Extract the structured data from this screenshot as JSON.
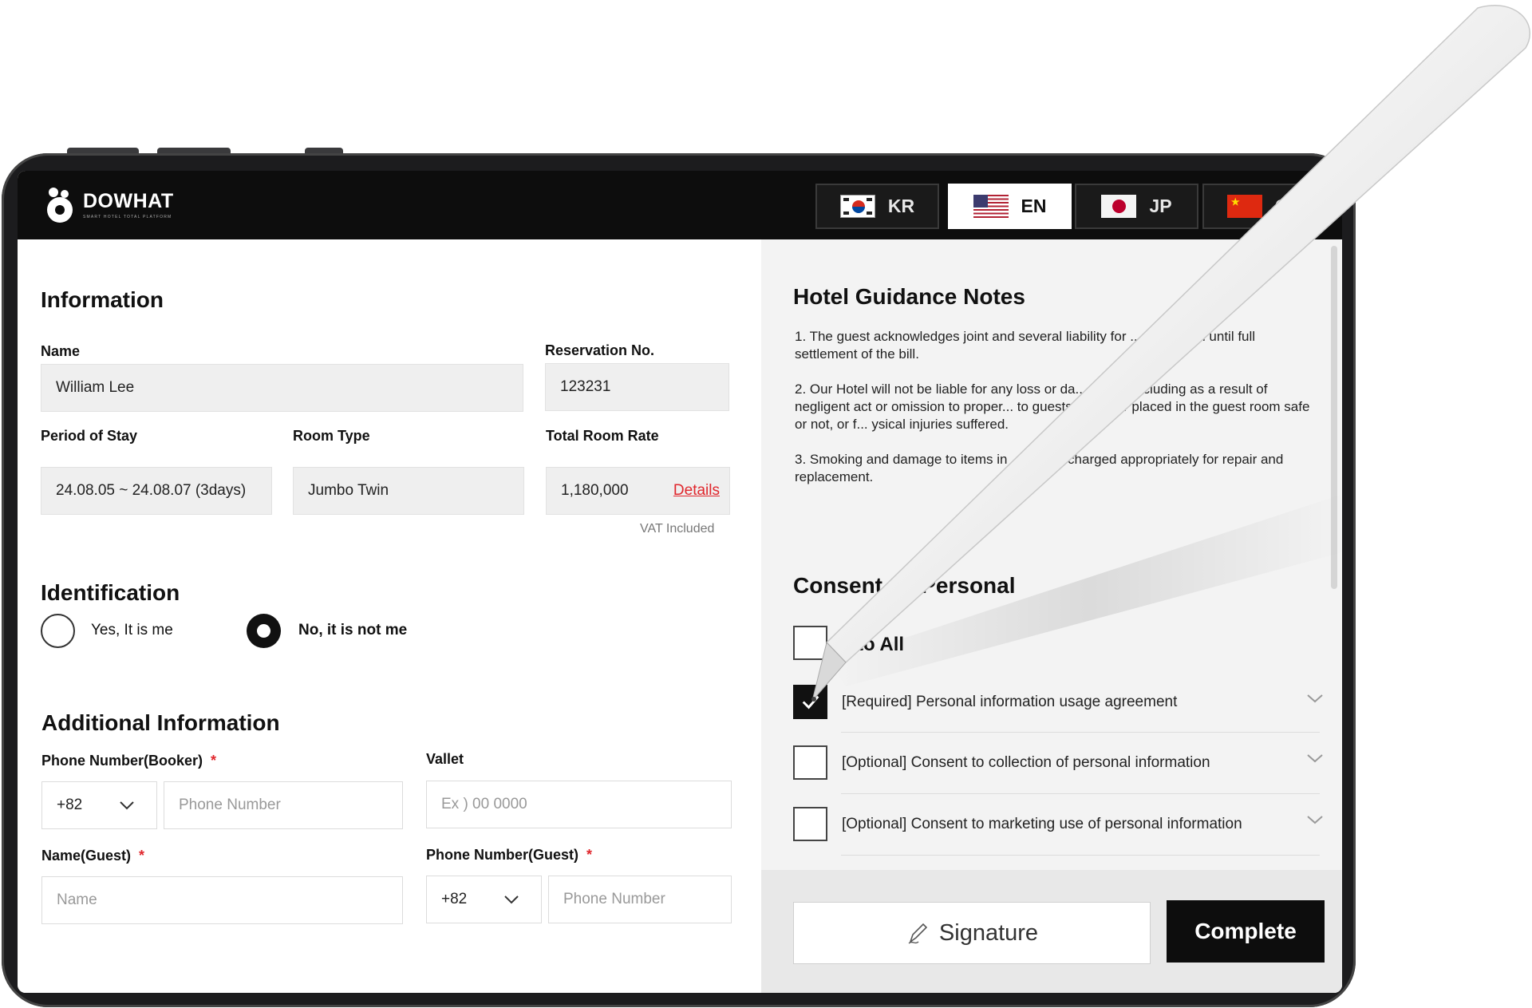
{
  "brand": {
    "name": "DOWHAT",
    "tagline": "SMART HOTEL TOTAL PLATFORM"
  },
  "languages": [
    {
      "code": "KR",
      "flag": "korea-flag-icon"
    },
    {
      "code": "EN",
      "flag": "usa-flag-icon",
      "active": true
    },
    {
      "code": "JP",
      "flag": "japan-flag-icon"
    },
    {
      "code": "CN",
      "flag": "china-flag-icon"
    }
  ],
  "info": {
    "title": "Information",
    "name_label": "Name",
    "name_value": "William Lee",
    "reservation_label": "Reservation No.",
    "reservation_value": "123231",
    "period_label": "Period of Stay",
    "period_value": "24.08.05 ~ 24.08.07 (3days)",
    "room_type_label": "Room Type",
    "room_type_value": "Jumbo Twin",
    "rate_label": "Total Room Rate",
    "rate_value": "1,180,000",
    "details_link": "Details",
    "vat_note": "VAT Included"
  },
  "identification": {
    "title": "Identification",
    "yes_label": "Yes, It is me",
    "no_label": "No, it is not me",
    "selected": "no"
  },
  "additional": {
    "title": "Additional Information",
    "phone_booker_label": "Phone Number(Booker)",
    "required_mark": "*",
    "country_code": "+82",
    "phone_placeholder": "Phone Number",
    "vallet_label": "Vallet",
    "vallet_placeholder": "Ex ) 00   0000",
    "guest_name_label": "Name(Guest)",
    "guest_name_placeholder": "Name",
    "phone_guest_label": "Phone Number(Guest)",
    "guest_country_code": "+82",
    "guest_phone_placeholder": "Phone Number"
  },
  "guidance": {
    "title": "Hotel Guidance Notes",
    "notes": [
      "1. The guest acknowledges joint and several liability for ... registered until full settlement of the bill.",
      "2. Our Hotel will not be liable for any loss or da... nature including as a result of negligent act or omission to proper... to guests, whether placed in the guest room safe or not, or f... ysical injuries suffered.",
      "3. Smoking and damage to items in ... will be charged appropriately for repair and replacement."
    ]
  },
  "consent": {
    "title": "Consent t... Personal",
    "all_label": "...to All",
    "items": [
      {
        "label": "[Required] Personal information usage agreement",
        "checked": true
      },
      {
        "label": "[Optional] Consent to collection of personal information",
        "checked": false
      },
      {
        "label": "[Optional] Consent to marketing use of personal information",
        "checked": false
      }
    ]
  },
  "actions": {
    "signature": "Signature",
    "complete": "Complete"
  }
}
